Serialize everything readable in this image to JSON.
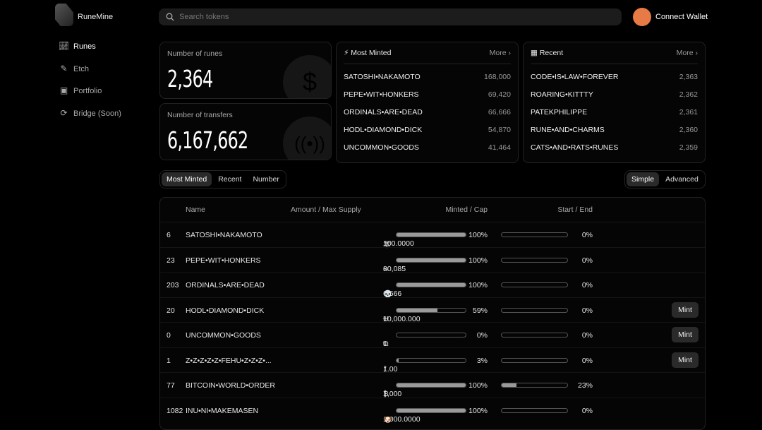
{
  "app": {
    "name": "RuneMine",
    "accent": "#e87a45"
  },
  "sidebar": {
    "items": [
      {
        "label": "Runes",
        "icon": "chart-line-icon",
        "active": true
      },
      {
        "label": "Etch",
        "icon": "etch-icon"
      },
      {
        "label": "Portfolio",
        "icon": "wallet-icon"
      },
      {
        "label": "Bridge (Soon)",
        "icon": "bridge-icon"
      }
    ]
  },
  "header": {
    "search_placeholder": "Search tokens",
    "connect_label": "Connect Wallet"
  },
  "stats": [
    {
      "label": "Number of runes",
      "value": "2,364",
      "icon": "dollar-coin-icon"
    },
    {
      "label": "Number of transfers",
      "value": "6,167,662",
      "icon": "broadcast-coin-icon"
    }
  ],
  "most_minted": {
    "title": "Most Minted",
    "more": "More",
    "items": [
      {
        "name": "SATOSHI•NAKAMOTO",
        "value": "168,000"
      },
      {
        "name": "PEPE•WIT•HONKERS",
        "value": "69,420"
      },
      {
        "name": "ORDINALS•ARE•DEAD",
        "value": "66,666"
      },
      {
        "name": "HODL•DIAMOND•DICK",
        "value": "54,870"
      },
      {
        "name": "UNCOMMON•GOODS",
        "value": "41,464"
      }
    ]
  },
  "recent": {
    "title": "Recent",
    "more": "More",
    "items": [
      {
        "name": "CODE•IS•LAW•FOREVER",
        "value": "2,363"
      },
      {
        "name": "ROARING•KITTTY",
        "value": "2,362"
      },
      {
        "name": "PATEKPHILIPPE",
        "value": "2,361"
      },
      {
        "name": "RUNE•AND•CHARMS",
        "value": "2,360"
      },
      {
        "name": "CATS•AND•RATS•RUNES",
        "value": "2,359"
      }
    ]
  },
  "tabs": [
    {
      "label": "Most Minted",
      "active": true
    },
    {
      "label": "Recent"
    },
    {
      "label": "Number"
    }
  ],
  "modes": [
    {
      "label": "Simple",
      "active": true
    },
    {
      "label": "Advanced"
    }
  ],
  "table": {
    "headers": {
      "name": "Name",
      "amount": "Amount / Max Supply",
      "minted": "Minted / Cap",
      "start": "Start / End"
    },
    "mint_label": "Mint",
    "rows": [
      {
        "rank": "6",
        "name": "SATOSHI•NAKAMOTO",
        "amount": "100.0000",
        "symbol": "丰",
        "minted": 100,
        "minted_label": "100%",
        "start": 0,
        "start_label": "0%",
        "mint": false
      },
      {
        "rank": "23",
        "name": "PEPE•WIT•HONKERS",
        "amount": "80,085",
        "symbol": "∞",
        "minted": 100,
        "minted_label": "100%",
        "start": 0,
        "start_label": "0%",
        "mint": false
      },
      {
        "rank": "203",
        "name": "ORDINALS•ARE•DEAD",
        "amount": "6,666",
        "symbol": "💀",
        "minted": 100,
        "minted_label": "100%",
        "start": 0,
        "start_label": "0%",
        "mint": false
      },
      {
        "rank": "20",
        "name": "HODL•DIAMOND•DICK",
        "amount": "10,000.000",
        "symbol": "Ʉ",
        "minted": 59,
        "minted_label": "59%",
        "start": 0,
        "start_label": "0%",
        "mint": true
      },
      {
        "rank": "0",
        "name": "UNCOMMON•GOODS",
        "amount": "1",
        "symbol": "⧉",
        "minted": 0,
        "minted_label": "0%",
        "start": 0,
        "start_label": "0%",
        "mint": true
      },
      {
        "rank": "1",
        "name": "Z•Z•Z•Z•Z•FEHU•Z•Z•Z•...",
        "amount": "1.00",
        "symbol": "ᚠ",
        "minted": 3,
        "minted_label": "3%",
        "start": 0,
        "start_label": "0%",
        "mint": true
      },
      {
        "rank": "77",
        "name": "BITCOIN•WORLD•ORDER",
        "amount": "1,000",
        "symbol": "₿",
        "minted": 100,
        "minted_label": "100%",
        "start": 23,
        "start_label": "23%",
        "mint": false
      },
      {
        "rank": "1082",
        "name": "INU•NI•MAKEMASEN",
        "amount": "1,000.0000",
        "symbol": "🐶",
        "minted": 100,
        "minted_label": "100%",
        "start": 0,
        "start_label": "0%",
        "mint": false
      }
    ]
  }
}
